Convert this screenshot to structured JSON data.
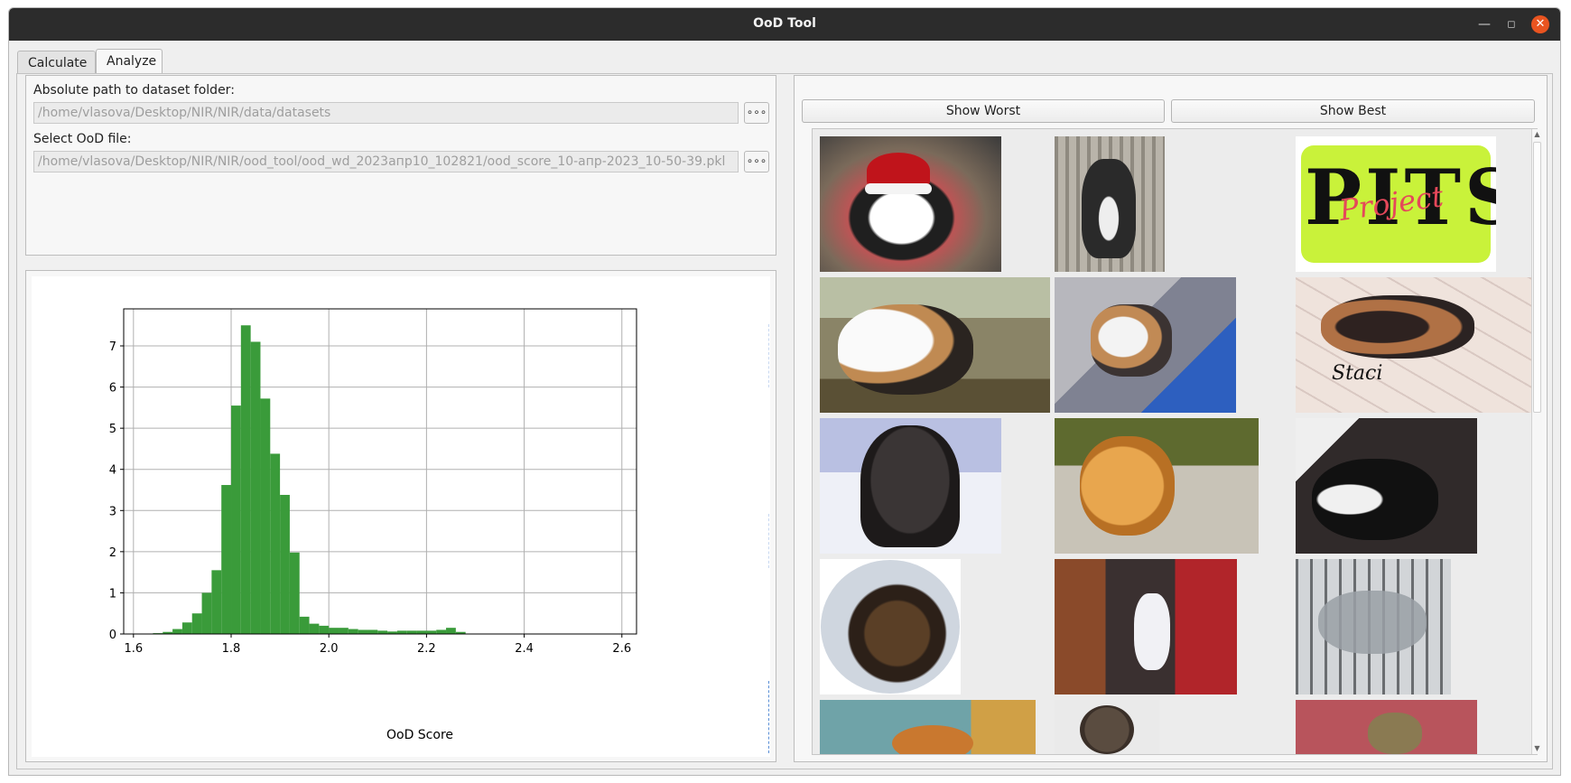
{
  "window": {
    "title": "OoD Tool"
  },
  "tabs": [
    {
      "label": "Calculate",
      "active": false
    },
    {
      "label": "Analyze",
      "active": true
    }
  ],
  "form": {
    "dataset_label": "Absolute path to dataset folder:",
    "dataset_path": "/home/vlasova/Desktop/NIR/NIR/data/datasets",
    "ood_label": "Select OoD file:",
    "ood_path": "/home/vlasova/Desktop/NIR/NIR/ood_tool/ood_wd_2023апр10_102821/ood_score_10-апр-2023_10-50-39.pkl",
    "browse_glyph": "∘∘∘"
  },
  "buttons": {
    "show_worst": "Show Worst",
    "show_best": "Show Best"
  },
  "chart_data": {
    "type": "bar",
    "xlabel": "OoD Score",
    "ylabel": "",
    "xlim": [
      1.58,
      2.63
    ],
    "ylim": [
      0,
      7.9
    ],
    "xticks": [
      1.6,
      1.8,
      2.0,
      2.2,
      2.4,
      2.6
    ],
    "yticks": [
      0,
      1,
      2,
      3,
      4,
      5,
      6,
      7
    ],
    "grid": true,
    "bar_color": "#3a9b3a",
    "bin_width": 0.02,
    "bin_starts": [
      1.64,
      1.66,
      1.68,
      1.7,
      1.72,
      1.74,
      1.76,
      1.78,
      1.8,
      1.82,
      1.84,
      1.86,
      1.88,
      1.9,
      1.92,
      1.94,
      1.96,
      1.98,
      2.0,
      2.02,
      2.04,
      2.06,
      2.08,
      2.1,
      2.12,
      2.14,
      2.16,
      2.18,
      2.2,
      2.22,
      2.24,
      2.26
    ],
    "values": [
      0.02,
      0.05,
      0.12,
      0.28,
      0.5,
      1.0,
      1.55,
      3.62,
      5.55,
      7.5,
      7.1,
      5.72,
      4.38,
      3.38,
      1.98,
      0.42,
      0.25,
      0.2,
      0.15,
      0.15,
      0.12,
      0.1,
      0.1,
      0.08,
      0.06,
      0.08,
      0.08,
      0.08,
      0.08,
      0.1,
      0.15,
      0.05
    ]
  },
  "gallery": [
    {
      "name": "cat-santa-hat"
    },
    {
      "name": "puppy-black-white"
    },
    {
      "name": "pits-project-logo",
      "text": "PITS",
      "subtext": "Project"
    },
    {
      "name": "calico-kitten"
    },
    {
      "name": "calico-on-newspaper"
    },
    {
      "name": "calico-staci",
      "caption": "Staci"
    },
    {
      "name": "black-fluffy-dog"
    },
    {
      "name": "golden-dog-on-patio"
    },
    {
      "name": "tuxedo-cat-petted"
    },
    {
      "name": "tabby-cat-round-photo"
    },
    {
      "name": "white-cat-doorway"
    },
    {
      "name": "cat-in-cage"
    },
    {
      "name": "orange-cat-partial"
    },
    {
      "name": "poodle-partial"
    },
    {
      "name": "tabby-red-background"
    }
  ]
}
